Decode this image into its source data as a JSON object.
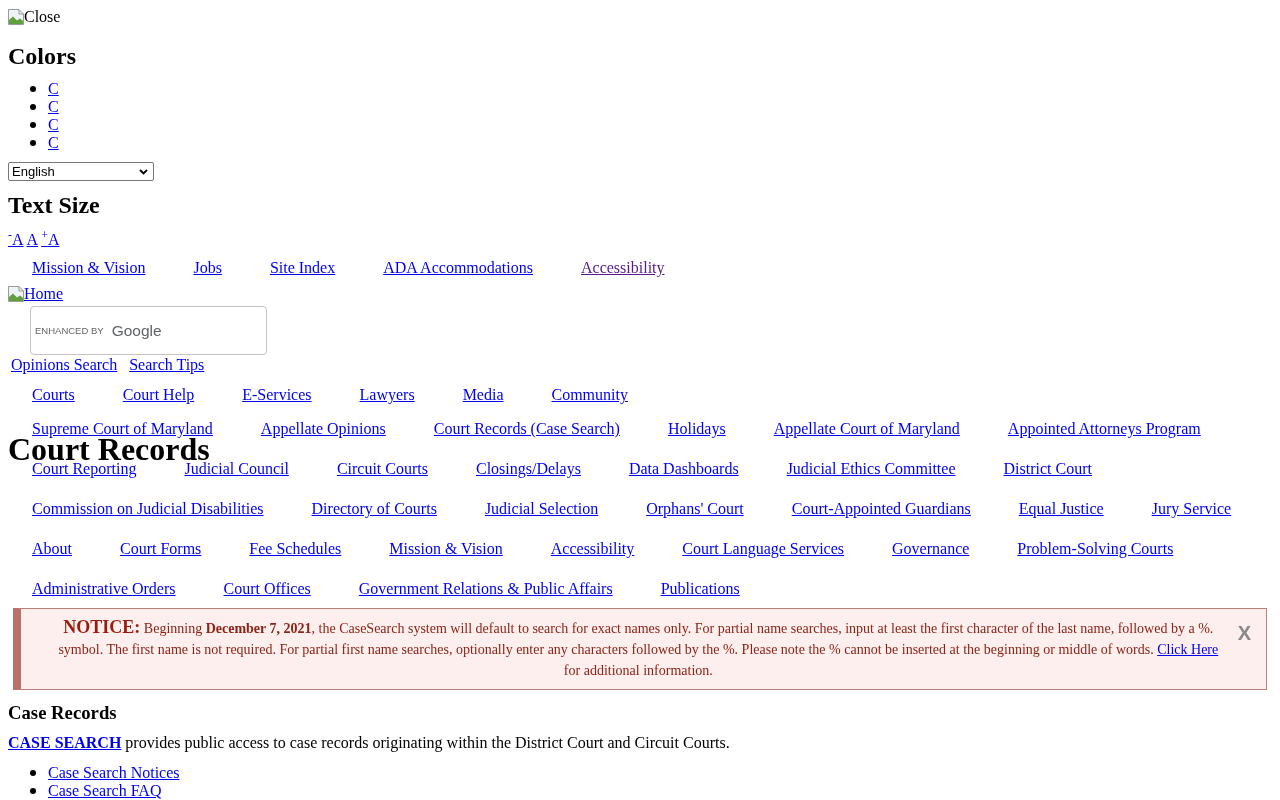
{
  "close_image": {
    "alt_text": "Close"
  },
  "colors_panel": {
    "heading": "Colors",
    "options": [
      "C",
      "C",
      "C",
      "C"
    ]
  },
  "language_select": {
    "value": "English"
  },
  "text_size": {
    "heading": "Text Size",
    "options": [
      "$^{-}$A",
      "A",
      "$^{+}$A"
    ]
  },
  "utility_nav": [
    {
      "label": "Mission & Vision",
      "visited": false
    },
    {
      "label": "Jobs",
      "visited": false
    },
    {
      "label": "Site Index",
      "visited": false
    },
    {
      "label": "ADA Accommodations",
      "visited": false
    },
    {
      "label": "Accessibility",
      "visited": true
    }
  ],
  "home_link": {
    "alt_text": "Home"
  },
  "search_box": {
    "watermark_label": "ENHANCED BY",
    "watermark_brand": "Google"
  },
  "search_links": [
    "Opinions Search",
    "Search Tips"
  ],
  "main_nav": [
    "Courts",
    "Court Help",
    "E-Services",
    "Lawyers",
    "Media",
    "Community"
  ],
  "menu_links": [
    "Supreme Court of Maryland",
    "Appellate Opinions",
    "Court Records (Case Search)",
    "Holidays",
    "Appellate Court of Maryland",
    "Appointed Attorneys Program",
    "Court Reporting",
    "Judicial Council",
    "Circuit Courts",
    "Closings/Delays",
    "Data Dashboards",
    "Judicial Ethics Committee",
    "District Court",
    "Commission on Judicial Disabilities",
    "Directory of Courts",
    "Judicial Selection",
    "Orphans' Court",
    "Court-Appointed Guardians",
    "Equal Justice",
    "Jury Service",
    "About",
    "Court Forms",
    "Fee Schedules",
    "Mission & Vision",
    "Accessibility",
    "Court Language Services",
    "Governance",
    "Problem-Solving Courts",
    "Administrative Orders",
    "Court Offices",
    "Government Relations & Public Affairs",
    "Publications"
  ],
  "page_title": "Court Records",
  "notice": {
    "label": "NOTICE:",
    "text": "Beginning **December 7, 2021**, the CaseSearch system will default to search for exact names only. For partial name searches, input at least the first character of the last name, followed by a %. symbol. The first name is not required. For partial first name searches, optionally enter any characters followed by the %. Please note the % cannot be inserted at the beginning or middle of words.",
    "link": "Click Here",
    "text_after": "for additional information.",
    "close": "X"
  },
  "section": {
    "heading": "Case Records",
    "intro_link": "CASE SEARCH",
    "intro_text": "provides public access to case records originating within the District Court and Circuit Courts.",
    "links": [
      "Case Search Notices",
      "Case Search FAQ"
    ]
  }
}
